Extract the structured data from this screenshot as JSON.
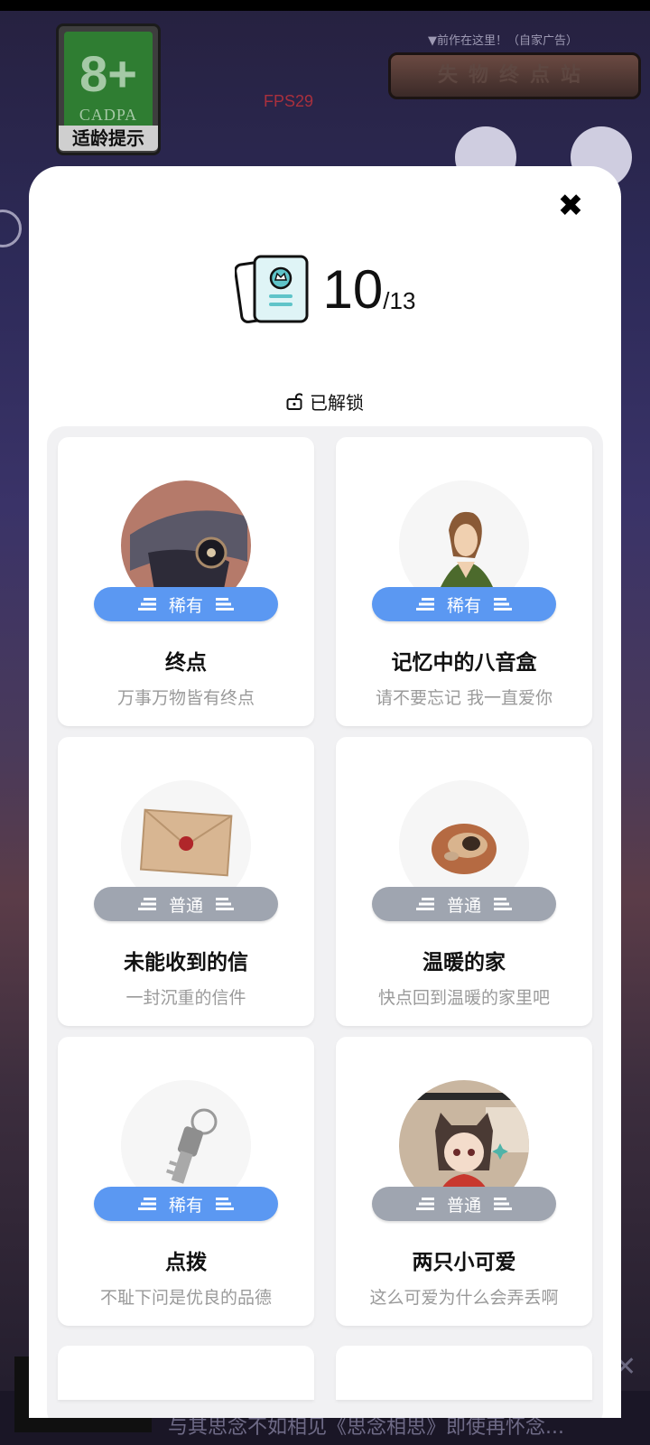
{
  "game": {
    "age_rating": {
      "number": "8+",
      "brand": "CADPA",
      "label": "适龄提示"
    },
    "fps": "FPS29",
    "ad_hint": "▼前作在这里！（自家广告）",
    "ad_button": "失物终点站",
    "bottom_text": "与其思念不如相见《思念相思》即使再怀念..."
  },
  "modal": {
    "collected": "10",
    "total": "/13",
    "unlocked_label": "已解锁",
    "items": [
      {
        "title": "终点",
        "desc": "万事万物皆有终点",
        "rarity": "稀有",
        "rarity_type": "rare",
        "image": "cap-icon"
      },
      {
        "title": "记忆中的八音盒",
        "desc": "请不要忘记 我一直爱你",
        "rarity": "稀有",
        "rarity_type": "rare",
        "image": "woman-icon"
      },
      {
        "title": "未能收到的信",
        "desc": "一封沉重的信件",
        "rarity": "普通",
        "rarity_type": "common",
        "image": "envelope-icon"
      },
      {
        "title": "温暖的家",
        "desc": "快点回到温暖的家里吧",
        "rarity": "普通",
        "rarity_type": "common",
        "image": "nest-icon"
      },
      {
        "title": "点拨",
        "desc": "不耻下问是优良的品德",
        "rarity": "稀有",
        "rarity_type": "rare",
        "image": "key-icon"
      },
      {
        "title": "两只小可爱",
        "desc": "这么可爱为什么会弄丢啊",
        "rarity": "普通",
        "rarity_type": "common",
        "image": "cat-girl-icon"
      }
    ]
  },
  "colors": {
    "rare": "#5b98f2",
    "common": "#9fa5b0",
    "accent": "#5fc4c9"
  }
}
